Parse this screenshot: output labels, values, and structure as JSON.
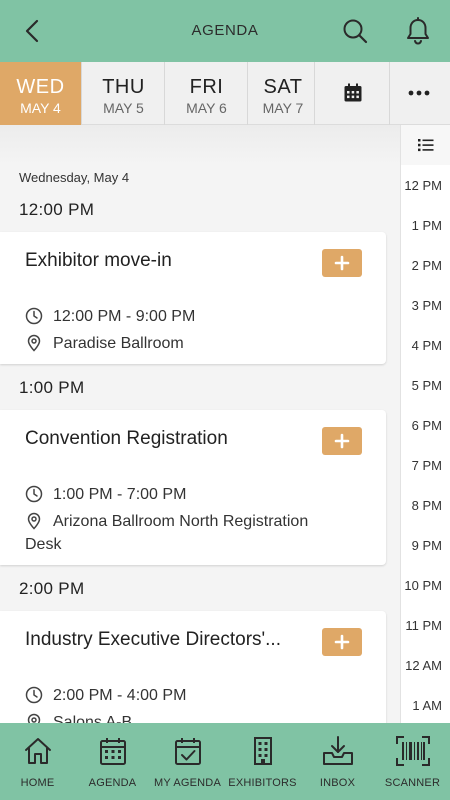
{
  "header": {
    "title": "AGENDA",
    "back_icon": "chevron-left-icon",
    "search_icon": "search-icon",
    "bell_icon": "bell-icon"
  },
  "days": [
    {
      "name": "WED",
      "date": "MAY 4",
      "active": true
    },
    {
      "name": "THU",
      "date": "MAY 5",
      "active": false
    },
    {
      "name": "FRI",
      "date": "MAY 6",
      "active": false
    },
    {
      "name": "SAT",
      "date": "MAY 7",
      "active": false
    }
  ],
  "day_toolbar": {
    "calendar_icon": "calendar-icon",
    "more_icon": "more-horizontal-icon"
  },
  "schedule": {
    "date_label": "Wednesday, May 4",
    "groups": [
      {
        "time": "12:00 PM",
        "session": {
          "title": "Exhibitor move-in",
          "time_range": "12:00 PM - 9:00 PM",
          "location": "Paradise Ballroom"
        }
      },
      {
        "time": "1:00 PM",
        "session": {
          "title": "Convention Registration",
          "time_range": "1:00 PM - 7:00 PM",
          "location": "Arizona Ballroom North Registration Desk"
        }
      },
      {
        "time": "2:00 PM",
        "session": {
          "title": "Industry Executive Directors'...",
          "time_range": "2:00 PM - 4:00 PM",
          "location": "Salons A-B"
        }
      }
    ]
  },
  "timeline": {
    "list_icon": "list-icon",
    "labels": [
      "12 PM",
      "1 PM",
      "2 PM",
      "3 PM",
      "4 PM",
      "5 PM",
      "6 PM",
      "7 PM",
      "8 PM",
      "9 PM",
      "10 PM",
      "11 PM",
      "12 AM",
      "1 AM"
    ]
  },
  "nav": [
    {
      "label": "HOME",
      "icon": "home-icon"
    },
    {
      "label": "AGENDA",
      "icon": "calendar-icon"
    },
    {
      "label": "MY AGENDA",
      "icon": "calendar-check-icon"
    },
    {
      "label": "EXHIBITORS",
      "icon": "building-icon"
    },
    {
      "label": "INBOX",
      "icon": "inbox-icon"
    },
    {
      "label": "SCANNER",
      "icon": "barcode-icon"
    }
  ],
  "colors": {
    "brand": "#80c3a4",
    "accent": "#dfa867",
    "background": "#f4f4f4"
  }
}
